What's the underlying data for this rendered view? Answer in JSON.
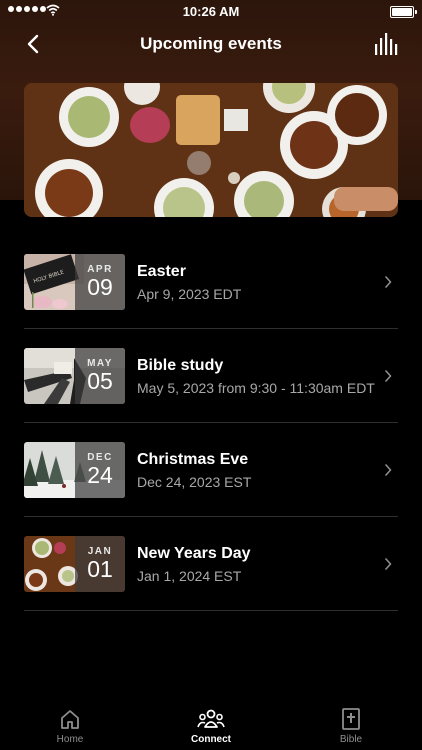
{
  "status_bar": {
    "time": "10:26 AM"
  },
  "header": {
    "title": "Upcoming events",
    "back_icon": "chevron-left-icon",
    "menu_icon": "bar-chart-icon"
  },
  "events": [
    {
      "month": "APR",
      "day": "09",
      "title": "Easter",
      "date": "Apr 9, 2023 EDT"
    },
    {
      "month": "MAY",
      "day": "05",
      "title": "Bible study",
      "date": "May 5, 2023 from 9:30 - 11:30am EDT"
    },
    {
      "month": "DEC",
      "day": "24",
      "title": "Christmas Eve",
      "date": "Dec 24, 2023 EST"
    },
    {
      "month": "JAN",
      "day": "01",
      "title": "New Years Day",
      "date": "Jan 1, 2024 EST"
    }
  ],
  "thumb_text": {
    "bible_cover": "HOLY BIBLE"
  },
  "tabbar": {
    "tabs": [
      {
        "label": "Home",
        "icon": "home-icon"
      },
      {
        "label": "Connect",
        "icon": "people-icon"
      },
      {
        "label": "Bible",
        "icon": "bible-icon"
      }
    ],
    "active": "Connect"
  },
  "colors": {
    "background": "#000000",
    "header": "#3a1c0e",
    "secondary_text": "#a8a8a8",
    "divider": "#2e2e2e"
  }
}
